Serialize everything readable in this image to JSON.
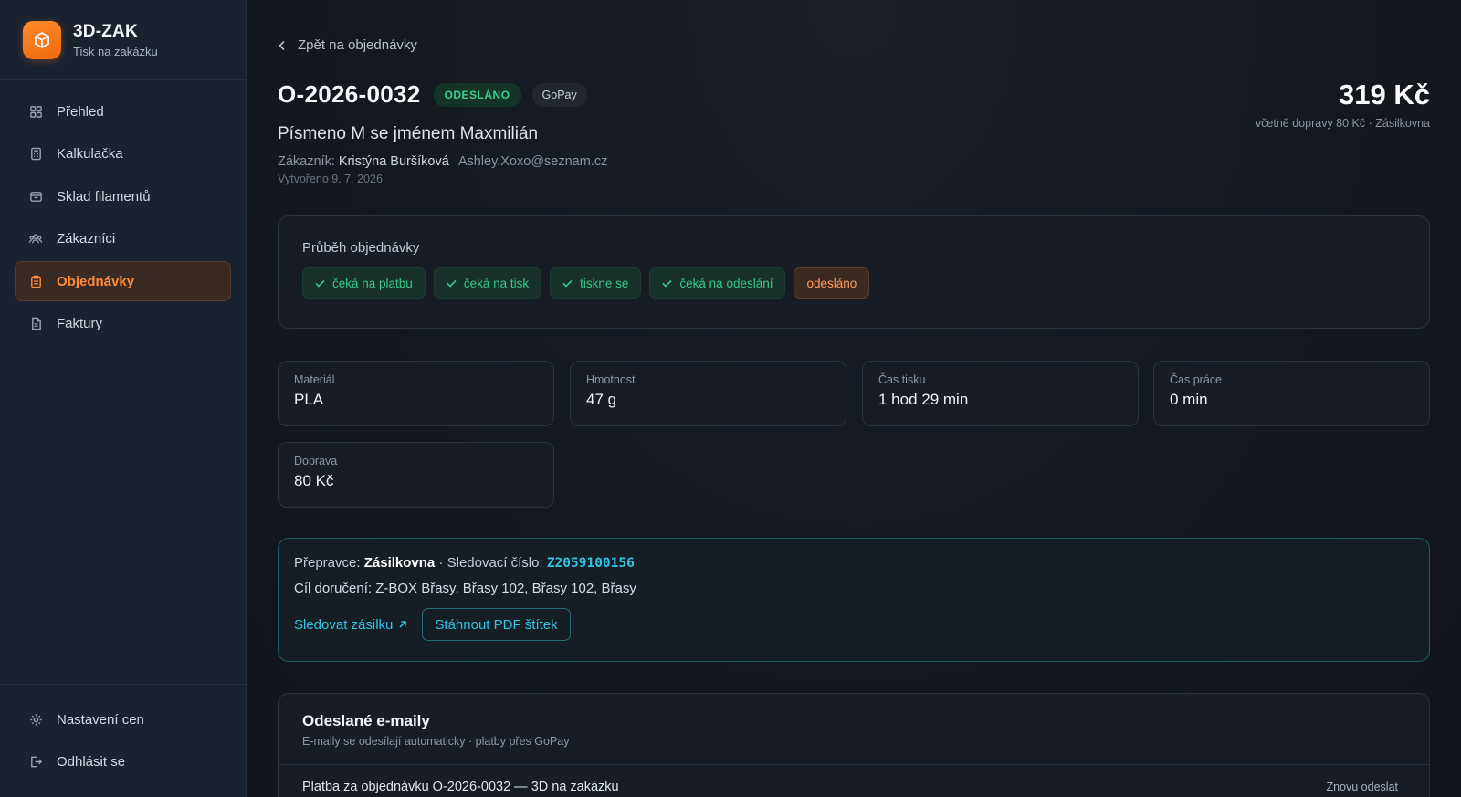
{
  "brand": {
    "name": "3D-ZAK",
    "subtitle": "Tisk na zakázku"
  },
  "nav": {
    "items": [
      {
        "label": "Přehled",
        "icon": "grid-icon"
      },
      {
        "label": "Kalkulačka",
        "icon": "calculator-icon"
      },
      {
        "label": "Sklad filamentů",
        "icon": "box-icon"
      },
      {
        "label": "Zákazníci",
        "icon": "users-icon"
      },
      {
        "label": "Objednávky",
        "icon": "clipboard-icon",
        "active": true
      },
      {
        "label": "Faktury",
        "icon": "document-icon"
      }
    ],
    "bottom": [
      {
        "label": "Nastavení cen",
        "icon": "gear-icon"
      },
      {
        "label": "Odhlásit se",
        "icon": "logout-icon"
      }
    ]
  },
  "back_link": "Zpět na objednávky",
  "order": {
    "id": "O-2026-0032",
    "status": "ODESLÁNO",
    "payment": "GoPay",
    "product": "Písmeno M se jménem Maxmilián",
    "customer_label": "Zákazník:",
    "customer_name": "Kristýna Buršíková",
    "customer_email": "Ashley.Xoxo@seznam.cz",
    "created": "Vytvořeno 9. 7. 2026",
    "price": "319 Kč",
    "price_note": "včetně dopravy 80 Kč · Zásilkovna"
  },
  "progress": {
    "label": "Průběh objednávky",
    "steps": [
      {
        "label": "čeká na platbu",
        "done": true
      },
      {
        "label": "čeká na tisk",
        "done": true
      },
      {
        "label": "tiskne se",
        "done": true
      },
      {
        "label": "čeká na odeslání",
        "done": true
      },
      {
        "label": "odesláno",
        "current": true
      }
    ]
  },
  "stats": [
    {
      "label": "Materiál",
      "value": "PLA"
    },
    {
      "label": "Hmotnost",
      "value": "47 g"
    },
    {
      "label": "Čas tisku",
      "value": "1 hod 29 min"
    },
    {
      "label": "Čas práce",
      "value": "0 min"
    },
    {
      "label": "Doprava",
      "value": "80 Kč"
    }
  ],
  "shipping": {
    "carrier_label": "Přepravce:",
    "carrier": "Zásilkovna",
    "tracking_label": "· Sledovací číslo:",
    "tracking_number": "Z2059100156",
    "destination": "Cíl doručení: Z-BOX Břasy, Břasy 102, Břasy 102, Břasy",
    "track_link": "Sledovat zásilku",
    "pdf_button": "Stáhnout PDF štítek"
  },
  "emails": {
    "title": "Odeslané e-maily",
    "subtitle": "E-maily se odesílají automaticky · platby přes GoPay",
    "rows": [
      {
        "subject": "Platba za objednávku O-2026-0032 — 3D na zakázku",
        "action": "Znovu odeslat"
      }
    ]
  },
  "colors": {
    "accent": "#ff8c3a",
    "success": "#3ecf8e",
    "link": "#33c3e0"
  }
}
